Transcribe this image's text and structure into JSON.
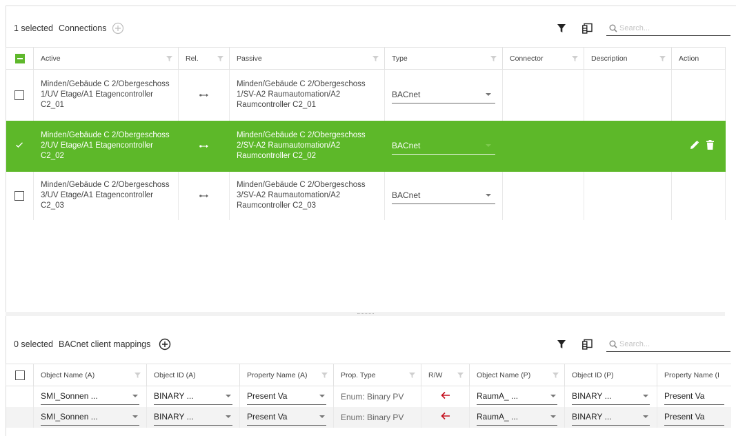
{
  "connections": {
    "selected_text": "1 selected",
    "title": "Connections",
    "search_placeholder": "Search...",
    "columns": [
      "Active",
      "Rel.",
      "Passive",
      "Type",
      "Connector",
      "Description",
      "Action"
    ],
    "rows": [
      {
        "active": "Minden/Gebäude C 2/Obergeschoss 1/UV Etage/A1 Etagencontroller C2_01",
        "passive": "Minden/Gebäude C 2/Obergeschoss 1/SV-A2 Raumautomation/A2 Raumcontroller C2_01",
        "type": "BACnet",
        "connector": "",
        "description": "",
        "selected": false
      },
      {
        "active": "Minden/Gebäude C 2/Obergeschoss 2/UV Etage/A1 Etagencontroller C2_02",
        "passive": "Minden/Gebäude C 2/Obergeschoss 2/SV-A2 Raumautomation/A2 Raumcontroller C2_02",
        "type": "BACnet",
        "connector": "",
        "description": "",
        "selected": true
      },
      {
        "active": "Minden/Gebäude C 2/Obergeschoss 3/UV Etage/A1 Etagencontroller C2_03",
        "passive": "Minden/Gebäude C 2/Obergeschoss 3/SV-A2 Raumautomation/A2 Raumcontroller C2_03",
        "type": "BACnet",
        "connector": "",
        "description": "",
        "selected": false
      }
    ]
  },
  "mappings": {
    "selected_text": "0 selected",
    "title": "BACnet client mappings",
    "search_placeholder": "Search...",
    "columns": [
      "Object Name (A)",
      "Object ID (A)",
      "Property Name (A)",
      "Prop. Type",
      "R/W",
      "Object Name (P)",
      "Object ID (P)",
      "Property Name (I"
    ],
    "rows": [
      {
        "obj_name_a": "SMI_Sonnen ...",
        "obj_id_a": "BINARY ...",
        "prop_name_a": "Present Va",
        "prop_type": "Enum: Binary PV",
        "obj_name_p": "RaumA_ ...",
        "obj_id_p": "BINARY ...",
        "prop_name_p": "Present Va"
      },
      {
        "obj_name_a": "SMI_Sonnen ...",
        "obj_id_a": "BINARY ...",
        "prop_name_a": "Present Va",
        "prop_type": "Enum: Binary PV",
        "obj_name_p": "RaumA_ ...",
        "obj_id_p": "BINARY ...",
        "prop_name_p": "Present Va"
      }
    ]
  },
  "icons": {
    "filter": "filter-icon",
    "columns": "column-chooser-icon",
    "search": "search-icon",
    "add": "add-circle-icon",
    "relation": "relation-arrow-icon",
    "edit": "edit-pencil-icon",
    "delete": "delete-trash-icon",
    "read_arrow": "left-arrow-icon"
  },
  "colors": {
    "accent_green": "#5db829",
    "arrow_red": "#c40f1e"
  }
}
